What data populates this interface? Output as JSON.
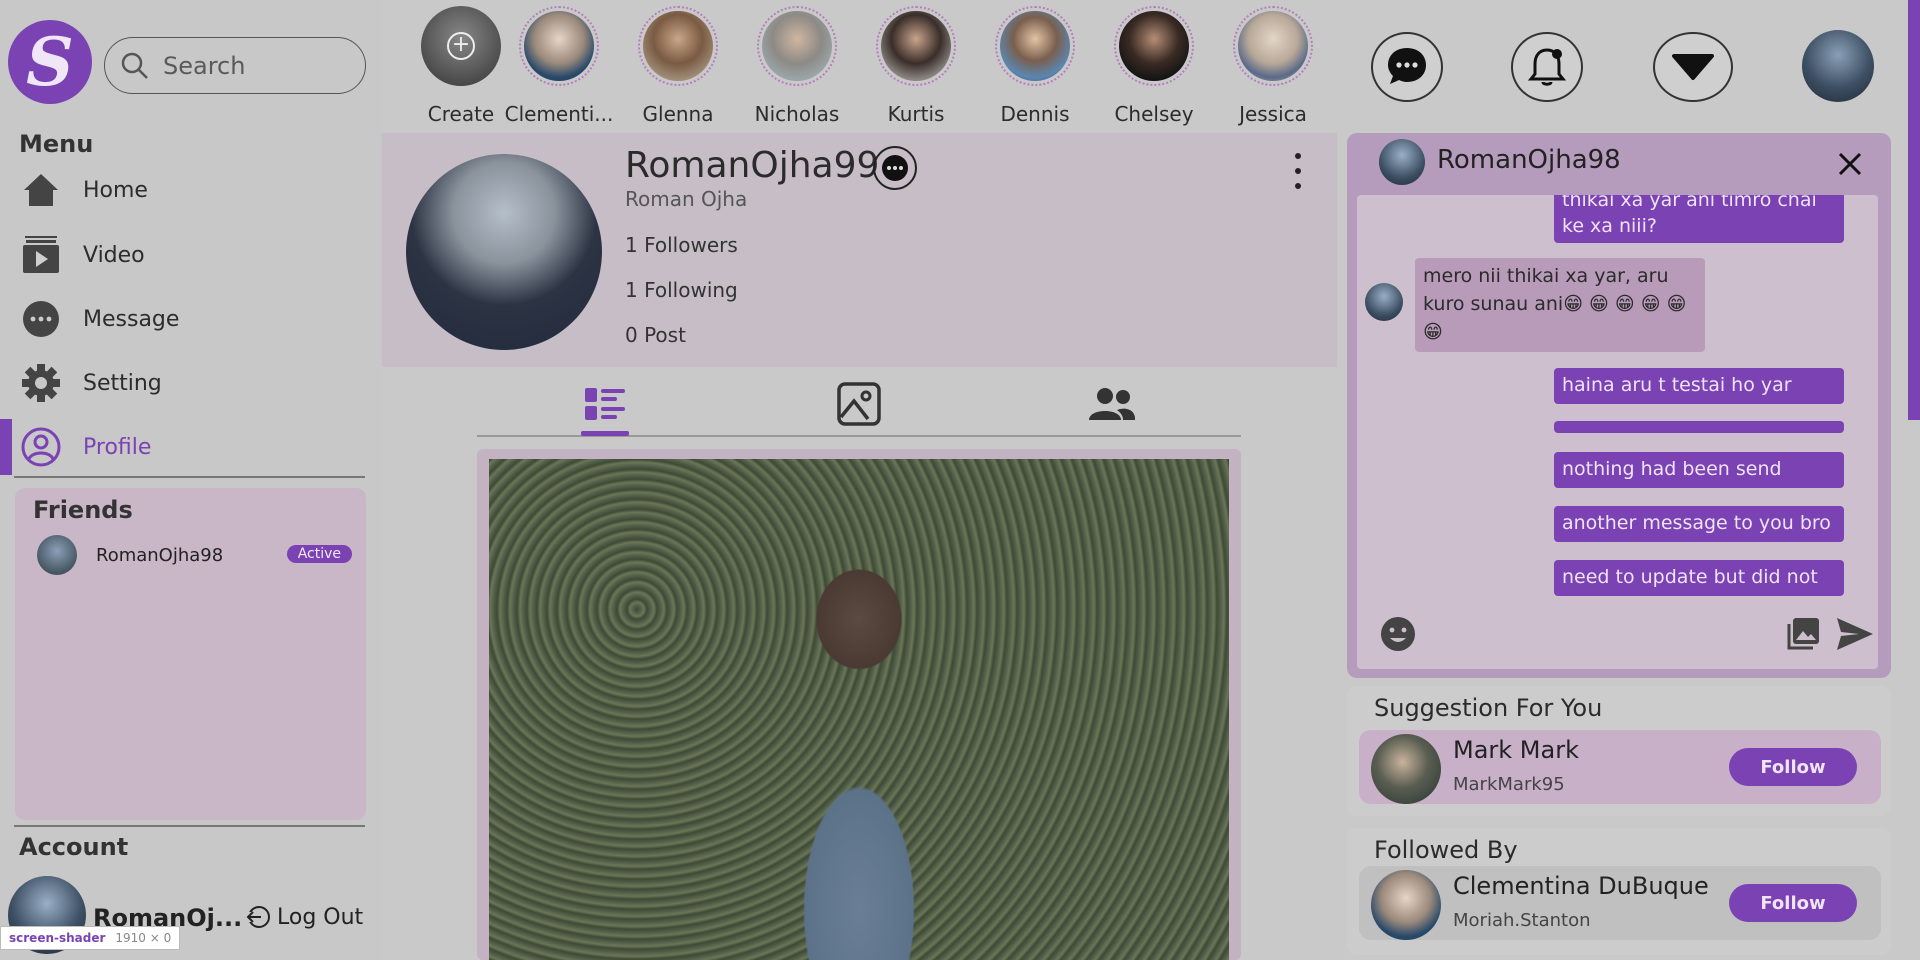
{
  "brand": {
    "logo_letter": "S"
  },
  "search": {
    "placeholder": "Search"
  },
  "sidebar": {
    "menu_heading": "Menu",
    "items": [
      {
        "label": "Home",
        "icon": "home-icon"
      },
      {
        "label": "Video",
        "icon": "video-icon"
      },
      {
        "label": "Message",
        "icon": "message-icon"
      },
      {
        "label": "Setting",
        "icon": "gear-icon"
      },
      {
        "label": "Profile",
        "icon": "profile-icon",
        "active": true
      }
    ]
  },
  "friends": {
    "title": "Friends",
    "list": [
      {
        "name": "RomanOjha98",
        "status": "Active"
      }
    ]
  },
  "account": {
    "heading": "Account",
    "name": "RomanOj...",
    "logout_label": "Log Out"
  },
  "screen_shader": {
    "label": "screen-shader",
    "size": "1910 × 0"
  },
  "stories": [
    {
      "label": "Create"
    },
    {
      "label": "Clementi..."
    },
    {
      "label": "Glenna"
    },
    {
      "label": "Nicholas"
    },
    {
      "label": "Kurtis"
    },
    {
      "label": "Dennis"
    },
    {
      "label": "Chelsey"
    },
    {
      "label": "Jessica"
    }
  ],
  "topbar": {
    "icons": [
      "chat-icon",
      "bell-icon",
      "dropdown-icon"
    ]
  },
  "profile": {
    "username": "RomanOjha99",
    "full_name": "Roman Ojha",
    "followers": "1 Followers",
    "following": "1 Following",
    "posts": "0 Post",
    "tabs": [
      "posts-tab",
      "photos-tab",
      "friends-tab"
    ],
    "active_tab": "posts-tab"
  },
  "chat": {
    "title": "RomanOjha98",
    "messages": [
      {
        "from": "me",
        "text": "thikai xa yar ani timro chai ke xa niii?"
      },
      {
        "from": "them",
        "text": "mero nii thikai xa yar, aru kuro sunau ani😁 😁 😁 😁 😁 😁"
      },
      {
        "from": "me",
        "text": "haina aru t testai ho yar"
      },
      {
        "from": "me",
        "text": ""
      },
      {
        "from": "me",
        "text": "nothing had been send"
      },
      {
        "from": "me",
        "text": "another message to you bro"
      },
      {
        "from": "me",
        "text": "need to update but did not"
      }
    ]
  },
  "suggestion": {
    "title": "Suggestion For You",
    "people": [
      {
        "name": "Mark Mark",
        "handle": "MarkMark95",
        "button": "Follow"
      }
    ]
  },
  "followed_by": {
    "title": "Followed By",
    "people": [
      {
        "name": "Clementina DuBuque",
        "handle": "Moriah.Stanton",
        "button": "Follow"
      }
    ]
  },
  "colors": {
    "accent": "#7a42b3",
    "background": "#c9c9c9",
    "friends_panel": "#c9b6c7"
  }
}
